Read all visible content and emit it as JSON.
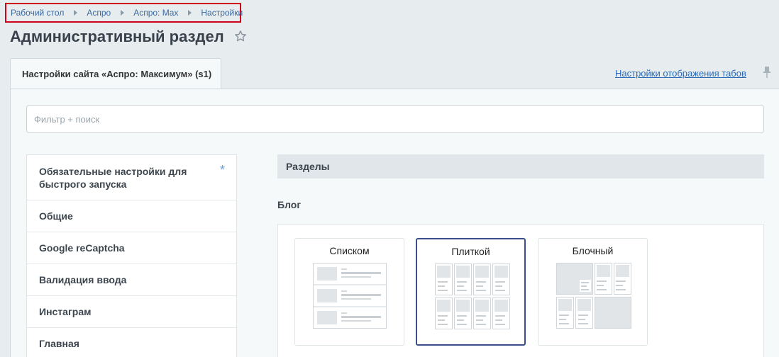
{
  "breadcrumb": {
    "items": [
      "Рабочий стол",
      "Аспро",
      "Аспро: Max",
      "Настройки"
    ]
  },
  "header": {
    "title": "Административный раздел"
  },
  "tabs": {
    "active_label": "Настройки сайта «Аспро: Максимум» (s1)",
    "settings_link": "Настройки отображения табов"
  },
  "filter": {
    "placeholder": "Фильтр + поиск",
    "value": ""
  },
  "sidebar": {
    "items": [
      {
        "label": "Обязательные настройки для быстрого запуска",
        "marker": "*"
      },
      {
        "label": "Общие"
      },
      {
        "label": "Google reCaptcha"
      },
      {
        "label": "Валидация ввода"
      },
      {
        "label": "Инстаграм"
      },
      {
        "label": "Главная"
      }
    ]
  },
  "content": {
    "section_header": "Разделы",
    "group_label": "Блог",
    "options": [
      {
        "label": "Списком",
        "selected": false
      },
      {
        "label": "Плиткой",
        "selected": true
      },
      {
        "label": "Блочный",
        "selected": false
      }
    ]
  },
  "colors": {
    "background": "#e7ecee",
    "accent_link": "#2a6ab8",
    "selected_border": "#3c4f8a",
    "highlight_box": "#d0021b"
  }
}
